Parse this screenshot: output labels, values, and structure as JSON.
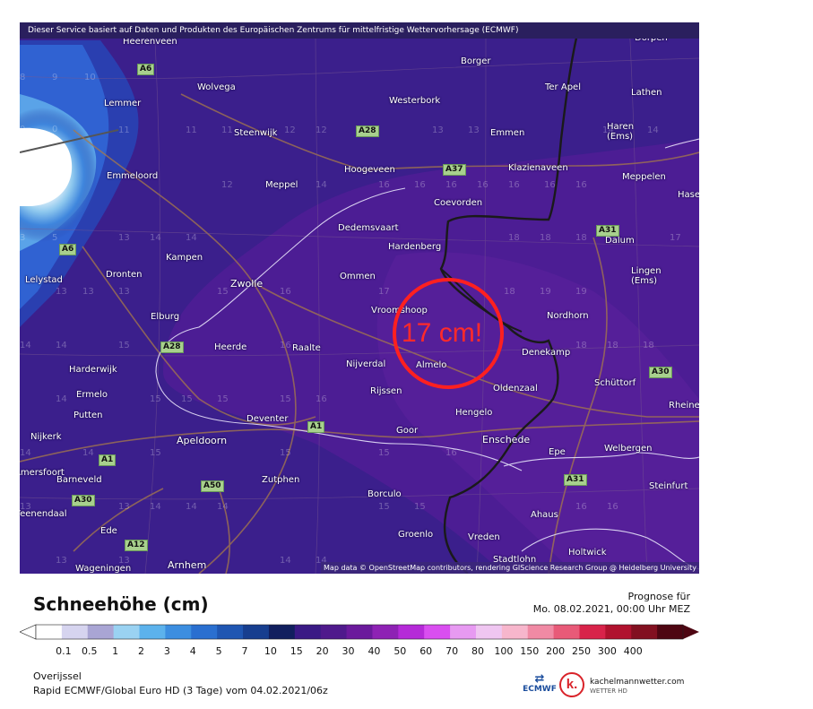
{
  "map": {
    "disclaimer": "Dieser Service basiert auf Daten und Produkten des Europäischen Zentrums für mittelfristige Wettervorhersage (ECMWF)",
    "attribution": "Map data © OpenStreetMap contributors, rendering GIScience Research Group @ Heidelberg University",
    "callout": "17 cm!",
    "cities": [
      "Heerenveen",
      "Dörpen",
      "Borger",
      "Wolvega",
      "Ter Apel",
      "Lathen",
      "Lemmer",
      "Westerbork",
      "Steenwijk",
      "Emmen",
      "Haren (Ems)",
      "Hoogeveen",
      "Klazienaveen",
      "Emmeloord",
      "Meppel",
      "Meppelen",
      "Coevorden",
      "Hase",
      "Dedemsvaart",
      "Dalum",
      "Hardenberg",
      "Kampen",
      "Lelystad",
      "Dronten",
      "Zwolle",
      "Ommen",
      "Lingen (Ems)",
      "Vroomshoop",
      "Nordhorn",
      "Elburg",
      "Heerde",
      "Raalte",
      "Denekamp",
      "Harderwijk",
      "Nijverdal",
      "Almelo",
      "Ermelo",
      "Rijssen",
      "Oldenzaal",
      "Schüttorf",
      "Rheine",
      "Putten",
      "Deventer",
      "Hengelo",
      "Goor",
      "Enschede",
      "Nijkerk",
      "Apeldoorn",
      "Epe",
      "Welbergen",
      "Barneveld",
      "Zutphen",
      "Borculo",
      "Steinfurt",
      "Ede",
      "Ahaus",
      "Groenlo",
      "Vreden",
      "Holtwick",
      "Wageningen",
      "Arnhem",
      "Stadtlohn",
      "Amersfoort",
      "Veenendaal"
    ],
    "roads": [
      "A6",
      "A6",
      "A28",
      "A37",
      "A31",
      "A28",
      "A1",
      "A1",
      "A50",
      "A30",
      "A12",
      "A31",
      "A30"
    ]
  },
  "legend": {
    "title": "Schneehöhe (cm)",
    "forecast_label": "Prognose für",
    "forecast_time": "Mo. 08.02.2021, 00:00 Uhr MEZ",
    "ticks": [
      "0.1",
      "0.5",
      "1",
      "2",
      "3",
      "4",
      "5",
      "7",
      "10",
      "15",
      "20",
      "30",
      "40",
      "50",
      "60",
      "70",
      "80",
      "100",
      "150",
      "200",
      "250",
      "300",
      "400"
    ],
    "colors": [
      "#ffffff",
      "#d6d4ef",
      "#a9a5d4",
      "#9ad2f2",
      "#5cb2ec",
      "#3c8ee0",
      "#2a6fd0",
      "#1f56b2",
      "#173e8f",
      "#111f5e",
      "#3a1a85",
      "#4f1a8c",
      "#6b1a9c",
      "#8e22b4",
      "#b52ad8",
      "#d94ef0",
      "#e79af2",
      "#efc6f1",
      "#f7b6cc",
      "#f08aa4",
      "#e85a78",
      "#d8234a",
      "#b0122e",
      "#821020",
      "#4e0612"
    ]
  },
  "footer": {
    "region": "Overijssel",
    "model": "Rapid ECMWF/Global Euro HD (3 Tage) vom 04.02.2021/06z",
    "ecmwf_logo": "ECMWF",
    "km_logo": "k.",
    "km_name": "kachelmannwetter.com",
    "km_sub": "WETTER HD"
  }
}
